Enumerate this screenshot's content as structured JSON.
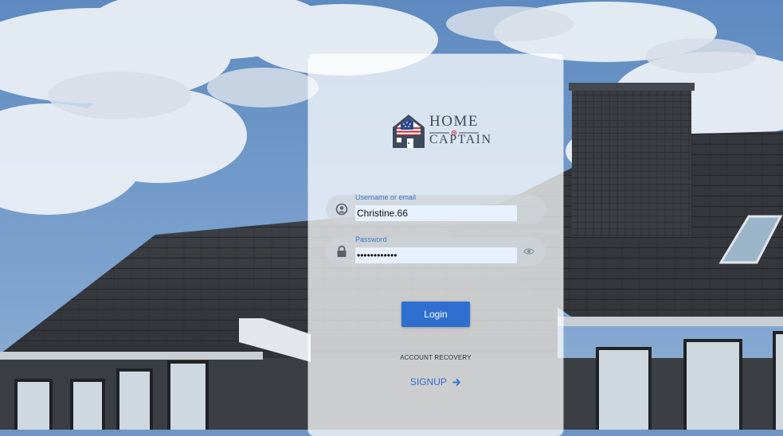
{
  "brand": {
    "line1": "HOME",
    "line2": "CAPTAIN"
  },
  "username": {
    "label": "Username or email",
    "value": "Christine.66",
    "icon": "user-circle-icon"
  },
  "password": {
    "label": "Password",
    "value": "password1234",
    "icon": "lock-icon",
    "toggle_icon": "eye-icon"
  },
  "actions": {
    "login_label": "Login",
    "recovery_label": "ACCOUNT RECOVERY",
    "signup_label": "SIGNUP",
    "signup_icon": "arrow-right-icon"
  },
  "colors": {
    "accent": "#2f6fd0",
    "label": "#3a77c9",
    "card": "rgba(255,255,255,0.74)",
    "autofill": "#e8f0fe"
  }
}
